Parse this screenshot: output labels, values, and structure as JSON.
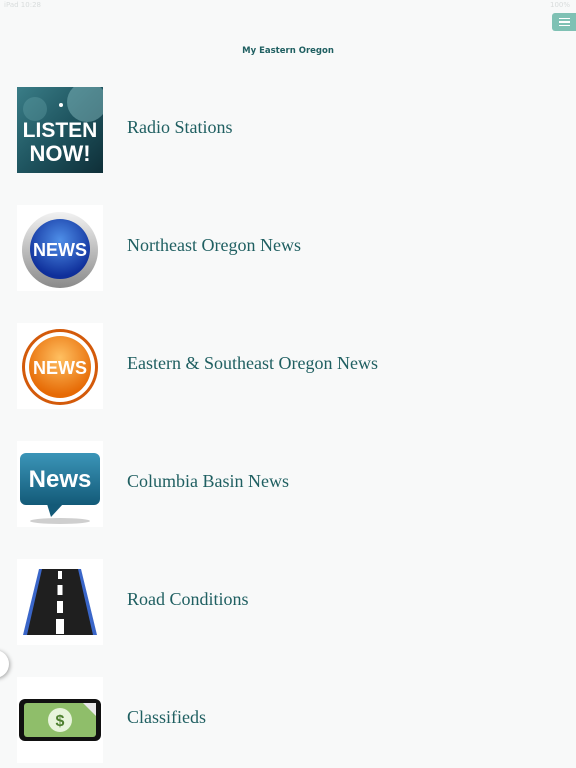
{
  "status_bar": {
    "left": "iPad  10:28",
    "right": "100%"
  },
  "header": {
    "title": "My Eastern Oregon"
  },
  "menu": {
    "icon": "hamburger-menu-icon"
  },
  "accent_color": "#7fc1b4",
  "text_color": "#1f5f61",
  "items": [
    {
      "label": "Radio Stations",
      "icon": "listen-now-icon",
      "icon_text_1": "LISTEN",
      "icon_text_2": "NOW!"
    },
    {
      "label": "Northeast Oregon News",
      "icon": "news-blue-button-icon",
      "icon_text": "NEWS"
    },
    {
      "label": "Eastern & Southeast Oregon News",
      "icon": "news-orange-button-icon",
      "icon_text": "NEWS"
    },
    {
      "label": "Columbia Basin News",
      "icon": "news-speech-bubble-icon",
      "icon_text": "News"
    },
    {
      "label": "Road Conditions",
      "icon": "road-icon"
    },
    {
      "label": "Classifieds",
      "icon": "dollar-bill-icon"
    }
  ]
}
